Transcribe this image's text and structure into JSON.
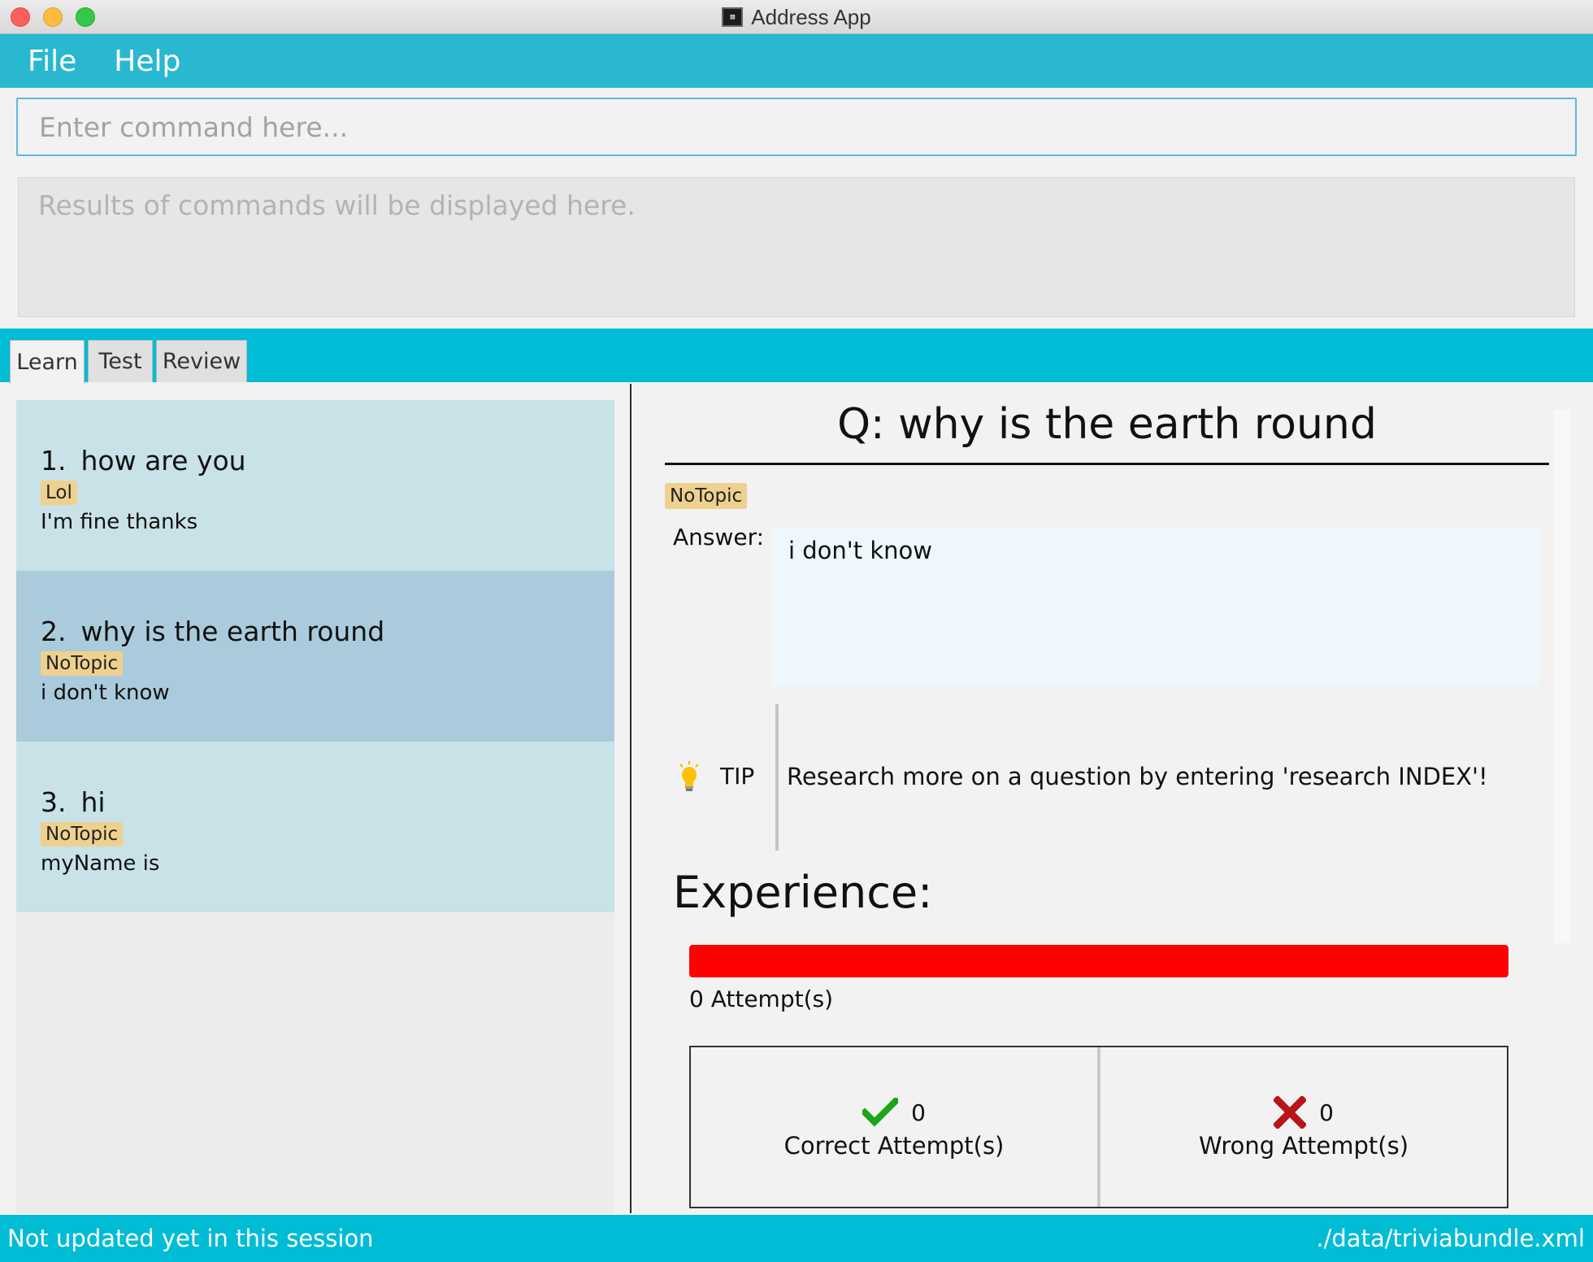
{
  "window": {
    "title": "Address App",
    "icon": "terminal-icon"
  },
  "menu": {
    "items": [
      "File",
      "Help"
    ]
  },
  "command": {
    "placeholder": "Enter command here...",
    "value": ""
  },
  "result": {
    "text": "Results of commands will be displayed here."
  },
  "tabs": [
    "Learn",
    "Test",
    "Review"
  ],
  "active_tab": "Learn",
  "list": {
    "items": [
      {
        "index": "1.",
        "question": "how are you",
        "tag": "Lol",
        "answer": "I'm fine thanks"
      },
      {
        "index": "2.",
        "question": "why is the earth round",
        "tag": "NoTopic",
        "answer": "i don't know"
      },
      {
        "index": "3.",
        "question": "hi",
        "tag": "NoTopic",
        "answer": "myName is"
      }
    ],
    "selected_index": 1
  },
  "detail": {
    "question": "Q: why is the earth round",
    "tag": "NoTopic",
    "answer_label": "Answer:",
    "answer": "i don't know",
    "tip_label": "TIP",
    "tip_text": "Research more on a question by entering 'research INDEX'!",
    "tip_icon": "lightbulb-icon",
    "experience_title": "Experience:",
    "experience_progress": 1.0,
    "experience_color": "#fe0000",
    "attempts_text": "0 Attempt(s)",
    "correct": {
      "count": "0",
      "label": "Correct Attempt(s)",
      "icon": "checkmark-icon",
      "color": "#1aa51a"
    },
    "wrong": {
      "count": "0",
      "label": "Wrong Attempt(s)",
      "icon": "cross-icon",
      "color": "#b8141c"
    }
  },
  "status": {
    "left": "Not updated yet in this session",
    "right": "./data/triviabundle.xml"
  },
  "colors": {
    "menubar": "#2ab8d0",
    "accent": "#00bcd4",
    "tag": "#efd18f",
    "card": "#c8e2e8",
    "card_selected": "#aacbdc"
  }
}
